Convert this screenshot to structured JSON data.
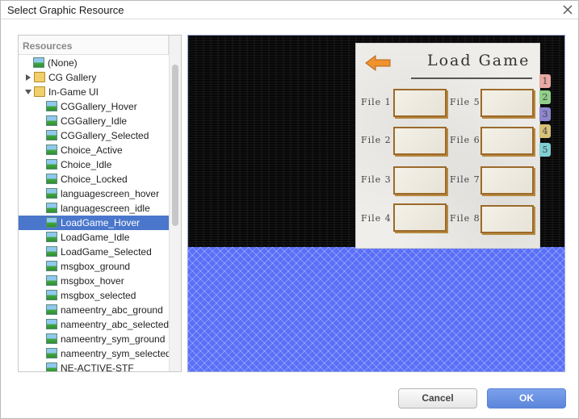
{
  "window": {
    "title": "Select Graphic Resource"
  },
  "tree": {
    "header": "Resources",
    "items": [
      {
        "label": "(None)",
        "type": "image",
        "level": 0,
        "selected": false
      },
      {
        "label": "CG Gallery",
        "type": "folder",
        "level": 0,
        "expanded": false,
        "selected": false
      },
      {
        "label": "In-Game UI",
        "type": "folder",
        "level": 0,
        "expanded": true,
        "selected": false
      },
      {
        "label": "CGGallery_Hover",
        "type": "image",
        "level": 1,
        "selected": false
      },
      {
        "label": "CGGallery_Idle",
        "type": "image",
        "level": 1,
        "selected": false
      },
      {
        "label": "CGGallery_Selected",
        "type": "image",
        "level": 1,
        "selected": false
      },
      {
        "label": "Choice_Active",
        "type": "image",
        "level": 1,
        "selected": false
      },
      {
        "label": "Choice_Idle",
        "type": "image",
        "level": 1,
        "selected": false
      },
      {
        "label": "Choice_Locked",
        "type": "image",
        "level": 1,
        "selected": false
      },
      {
        "label": "languagescreen_hover",
        "type": "image",
        "level": 1,
        "selected": false
      },
      {
        "label": "languagescreen_idle",
        "type": "image",
        "level": 1,
        "selected": false
      },
      {
        "label": "LoadGame_Hover",
        "type": "image",
        "level": 1,
        "selected": true
      },
      {
        "label": "LoadGame_Idle",
        "type": "image",
        "level": 1,
        "selected": false
      },
      {
        "label": "LoadGame_Selected",
        "type": "image",
        "level": 1,
        "selected": false
      },
      {
        "label": "msgbox_ground",
        "type": "image",
        "level": 1,
        "selected": false
      },
      {
        "label": "msgbox_hover",
        "type": "image",
        "level": 1,
        "selected": false
      },
      {
        "label": "msgbox_selected",
        "type": "image",
        "level": 1,
        "selected": false
      },
      {
        "label": "nameentry_abc_ground",
        "type": "image",
        "level": 1,
        "selected": false
      },
      {
        "label": "nameentry_abc_selected",
        "type": "image",
        "level": 1,
        "selected": false
      },
      {
        "label": "nameentry_sym_ground",
        "type": "image",
        "level": 1,
        "selected": false
      },
      {
        "label": "nameentry_sym_selected",
        "type": "image",
        "level": 1,
        "selected": false
      },
      {
        "label": "NE-ACTIVE-STF",
        "type": "image",
        "level": 1,
        "selected": false
      }
    ]
  },
  "preview": {
    "title": "Load Game",
    "files_left": [
      "File 1",
      "File 2",
      "File 3",
      "File 4"
    ],
    "files_right": [
      "File 5",
      "File 6",
      "File 7",
      "File 8"
    ],
    "tabs": [
      {
        "label": "1",
        "color": "#e8a9a2"
      },
      {
        "label": "2",
        "color": "#8fcf8a"
      },
      {
        "label": "3",
        "color": "#8f86cf"
      },
      {
        "label": "4",
        "color": "#d8c27a"
      },
      {
        "label": "5",
        "color": "#7fcfd3"
      }
    ],
    "arrow_color": "#f0922e"
  },
  "buttons": {
    "cancel": "Cancel",
    "ok": "OK"
  },
  "colors": {
    "selection": "#4a77cc",
    "ok_button": "#5c86db",
    "preview_background": "#5a6ff7"
  }
}
